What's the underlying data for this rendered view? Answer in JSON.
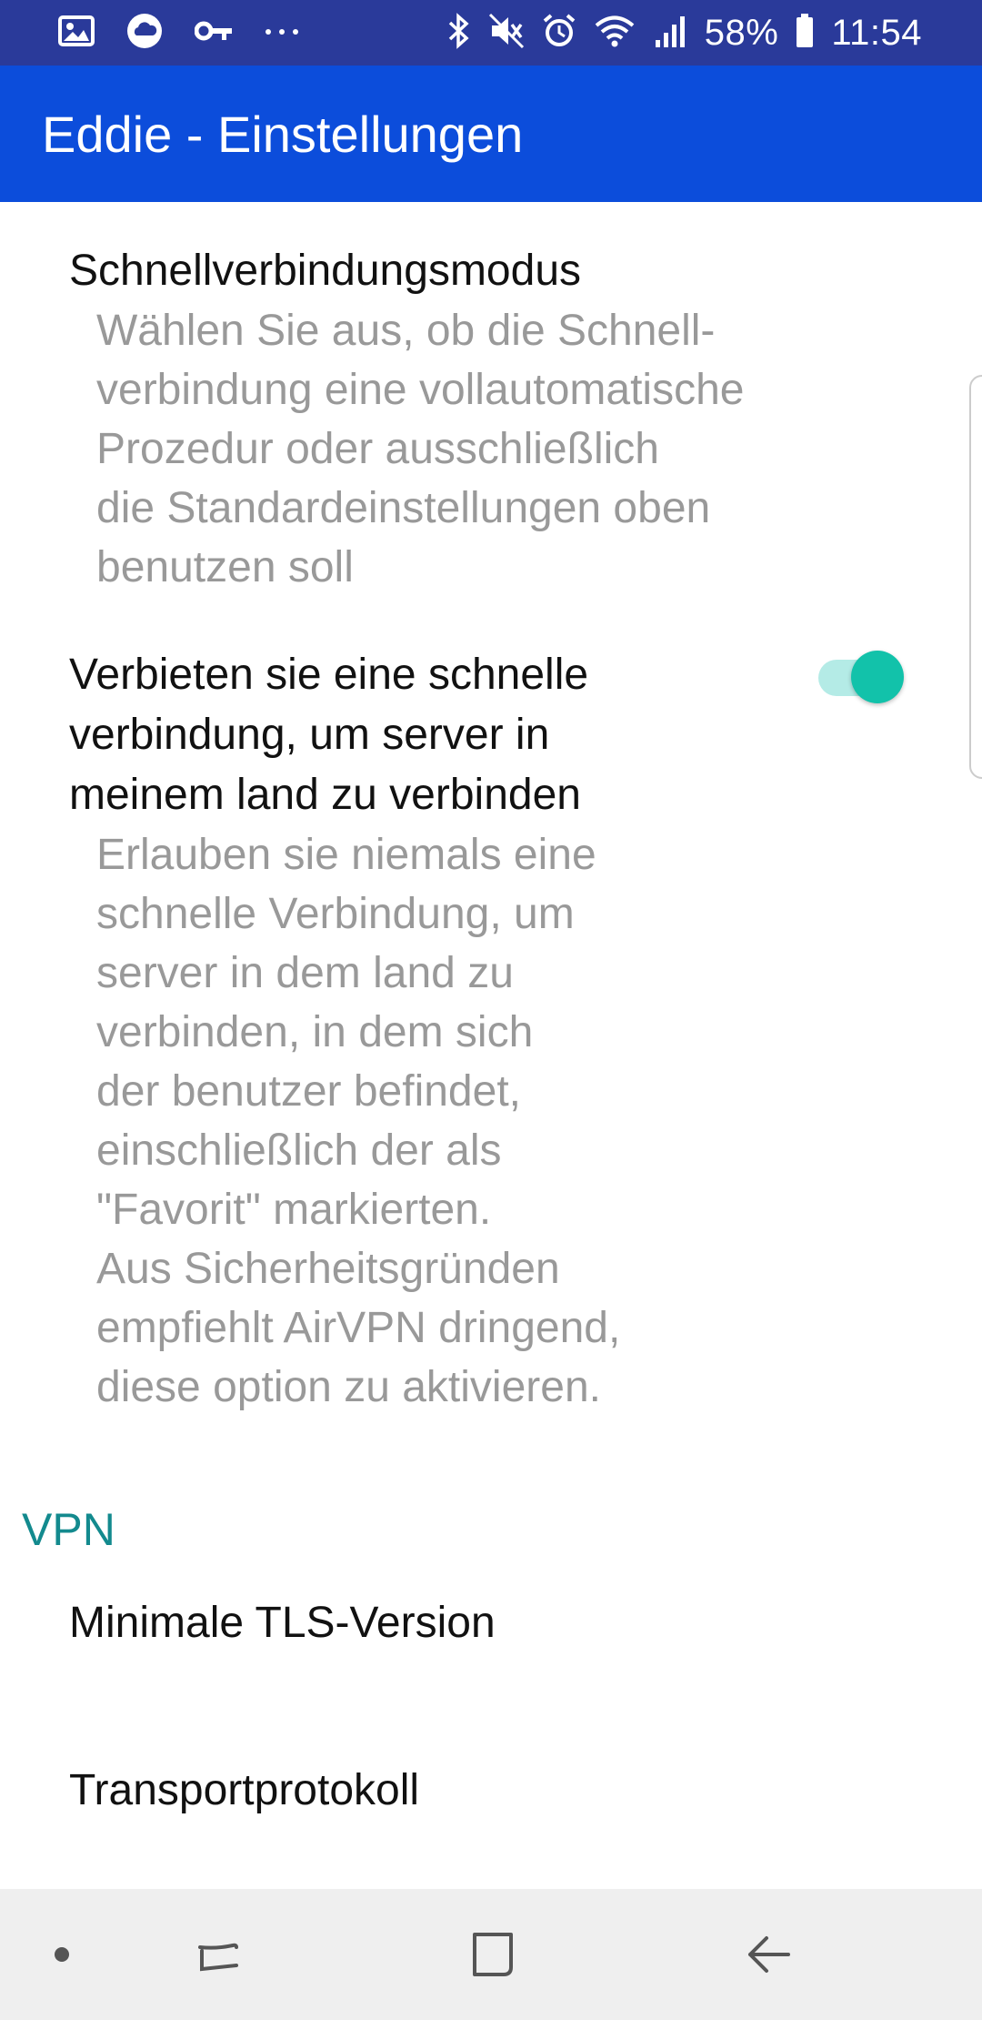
{
  "status_bar": {
    "battery": "58%",
    "time": "11:54",
    "icons_left": [
      "gallery-icon",
      "cloud-icon",
      "key-icon",
      "more-icon"
    ],
    "icons_right": [
      "bluetooth-icon",
      "mute-icon",
      "alarm-icon",
      "wifi-icon",
      "signal-icon",
      "battery-icon"
    ]
  },
  "toolbar": {
    "title": "Eddie - Einstellungen"
  },
  "prefs": [
    {
      "title": "Schnellverbindungsmodus",
      "summary": "Wählen Sie aus, ob die Schnell-\nverbindung eine vollautomatische\nProzedur oder ausschließlich\ndie Standardeinstellungen oben\nbenutzen soll"
    },
    {
      "title": "Verbieten sie eine schnelle\nverbindung, um server in\nmeinem land zu verbinden",
      "summary": "Erlauben sie niemals eine\nschnelle Verbindung, um\nserver in dem land zu\nverbinden, in dem sich\nder benutzer befindet,\neinschließlich der als\n\"Favorit\" markierten.\nAus Sicherheitsgründen\nempfiehlt AirVPN dringend,\ndiese option zu aktivieren.",
      "toggle_on": true
    }
  ],
  "category": {
    "label": "VPN"
  },
  "vpn_prefs": [
    {
      "title": "Minimale TLS-Version"
    },
    {
      "title": "Transportprotokoll"
    }
  ],
  "colors": {
    "status_bar": "#2a3a9a",
    "toolbar": "#0c4ddb",
    "accent": "#138a8e",
    "toggle_thumb": "#12c2aa",
    "toggle_track": "#b4ebe6",
    "summary_text": "#999999"
  },
  "nav_bar": {
    "buttons": [
      "dot-icon",
      "recents-icon",
      "home-icon",
      "back-icon"
    ]
  }
}
